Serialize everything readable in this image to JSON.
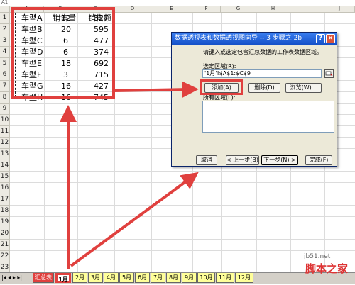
{
  "name_box": "A1",
  "columns": [
    "A",
    "B",
    "C",
    "D",
    "E",
    "F",
    "G",
    "H",
    "I",
    "J"
  ],
  "rows": [
    "1",
    "2",
    "3",
    "4",
    "5",
    "6",
    "7",
    "8",
    "9",
    "10",
    "11",
    "12",
    "13",
    "14",
    "15",
    "16",
    "17",
    "18",
    "19",
    "20",
    "21",
    "22",
    "23"
  ],
  "table": {
    "headers": [
      "车型",
      "销售量",
      "销售额"
    ],
    "data": [
      [
        "车型A",
        "12",
        "327"
      ],
      [
        "车型B",
        "20",
        "595"
      ],
      [
        "车型C",
        "6",
        "477"
      ],
      [
        "车型D",
        "6",
        "374"
      ],
      [
        "车型E",
        "18",
        "692"
      ],
      [
        "车型F",
        "3",
        "715"
      ],
      [
        "车型G",
        "16",
        "427"
      ],
      [
        "车型H",
        "16",
        "745"
      ]
    ]
  },
  "dialog": {
    "title": "数据透视表和数据透视图向导 -- 3 步骤之 2b",
    "help_btn": "?",
    "close_btn": "×",
    "instruction": "请键入或选定包含汇总数据的工作表数据区域。",
    "range_label": "选定区域(R):",
    "range_value": "'1月'!$A$1:$C$9",
    "add_btn": "添加(A)",
    "delete_btn": "删除(D)",
    "browse_btn": "浏览(W)...",
    "all_ranges_label": "所有区域(L):",
    "cancel_btn": "取消",
    "back_btn": "< 上一步(B)",
    "next_btn": "下一步(N) >",
    "finish_btn": "完成(F)"
  },
  "sheet_tabs": [
    "汇总表",
    "1月",
    "2月",
    "3月",
    "4月",
    "5月",
    "6月",
    "7月",
    "8月",
    "9月",
    "10月",
    "11月",
    "12月"
  ],
  "active_tab": "1月",
  "watermark": {
    "site": "jb51.net",
    "name": "脚本之家"
  },
  "colors": {
    "annotation": "#e0403e",
    "title_bar": "#1450c8",
    "tab_bg": "#ffff99"
  }
}
